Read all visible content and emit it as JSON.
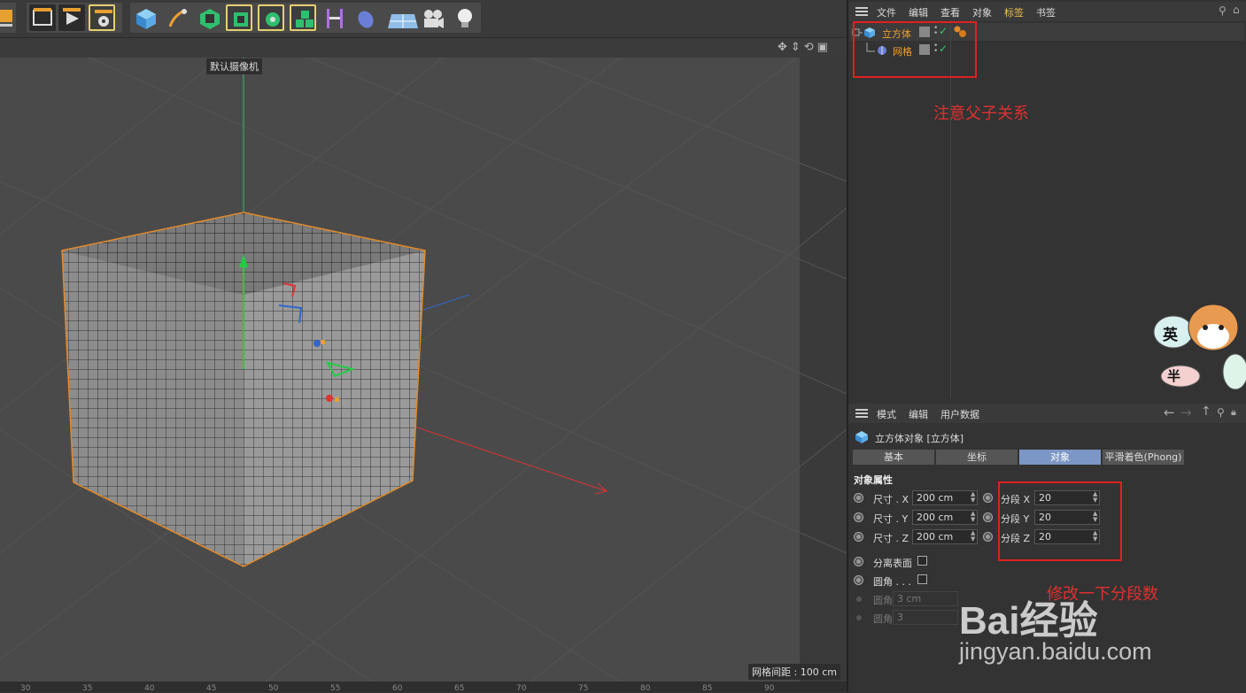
{
  "viewport": {
    "camera_label": "默认摄像机",
    "grid_spacing": "网格间距 : 100 cm",
    "ruler": [
      "30",
      "35",
      "40",
      "45",
      "50",
      "55",
      "60",
      "65",
      "70",
      "75",
      "80",
      "85",
      "90"
    ]
  },
  "object_manager": {
    "menu": [
      "文件",
      "编辑",
      "查看",
      "对象",
      "标签",
      "书签"
    ],
    "objects": [
      {
        "name": "立方体"
      },
      {
        "name": "网格"
      }
    ],
    "note": "注意父子关系"
  },
  "attributes": {
    "menu": [
      "模式",
      "编辑",
      "用户数据"
    ],
    "title": "立方体对象 [立方体]",
    "tabs": [
      "基本",
      "坐标",
      "对象",
      "平滑着色(Phong)"
    ],
    "active_tab": "对象",
    "section": "对象属性",
    "size": [
      {
        "label": "尺寸 . X",
        "value": "200 cm"
      },
      {
        "label": "尺寸 . Y",
        "value": "200 cm"
      },
      {
        "label": "尺寸 . Z",
        "value": "200 cm"
      }
    ],
    "segments": [
      {
        "label": "分段 X",
        "value": "20"
      },
      {
        "label": "分段 Y",
        "value": "20"
      },
      {
        "label": "分段 Z",
        "value": "20"
      }
    ],
    "separate_surfaces": "分离表面",
    "fillet": "圆角 . . .",
    "fillet_radius": {
      "label": "圆角半径",
      "value": "3 cm"
    },
    "fillet_subdivision": {
      "label": "圆角细分",
      "value": "3"
    },
    "note": "修改一下分段数"
  },
  "watermark": {
    "brand": "Bai经验",
    "url": "jingyan.baidu.com"
  },
  "sticker": {
    "top": "英",
    "bottom": "半"
  }
}
